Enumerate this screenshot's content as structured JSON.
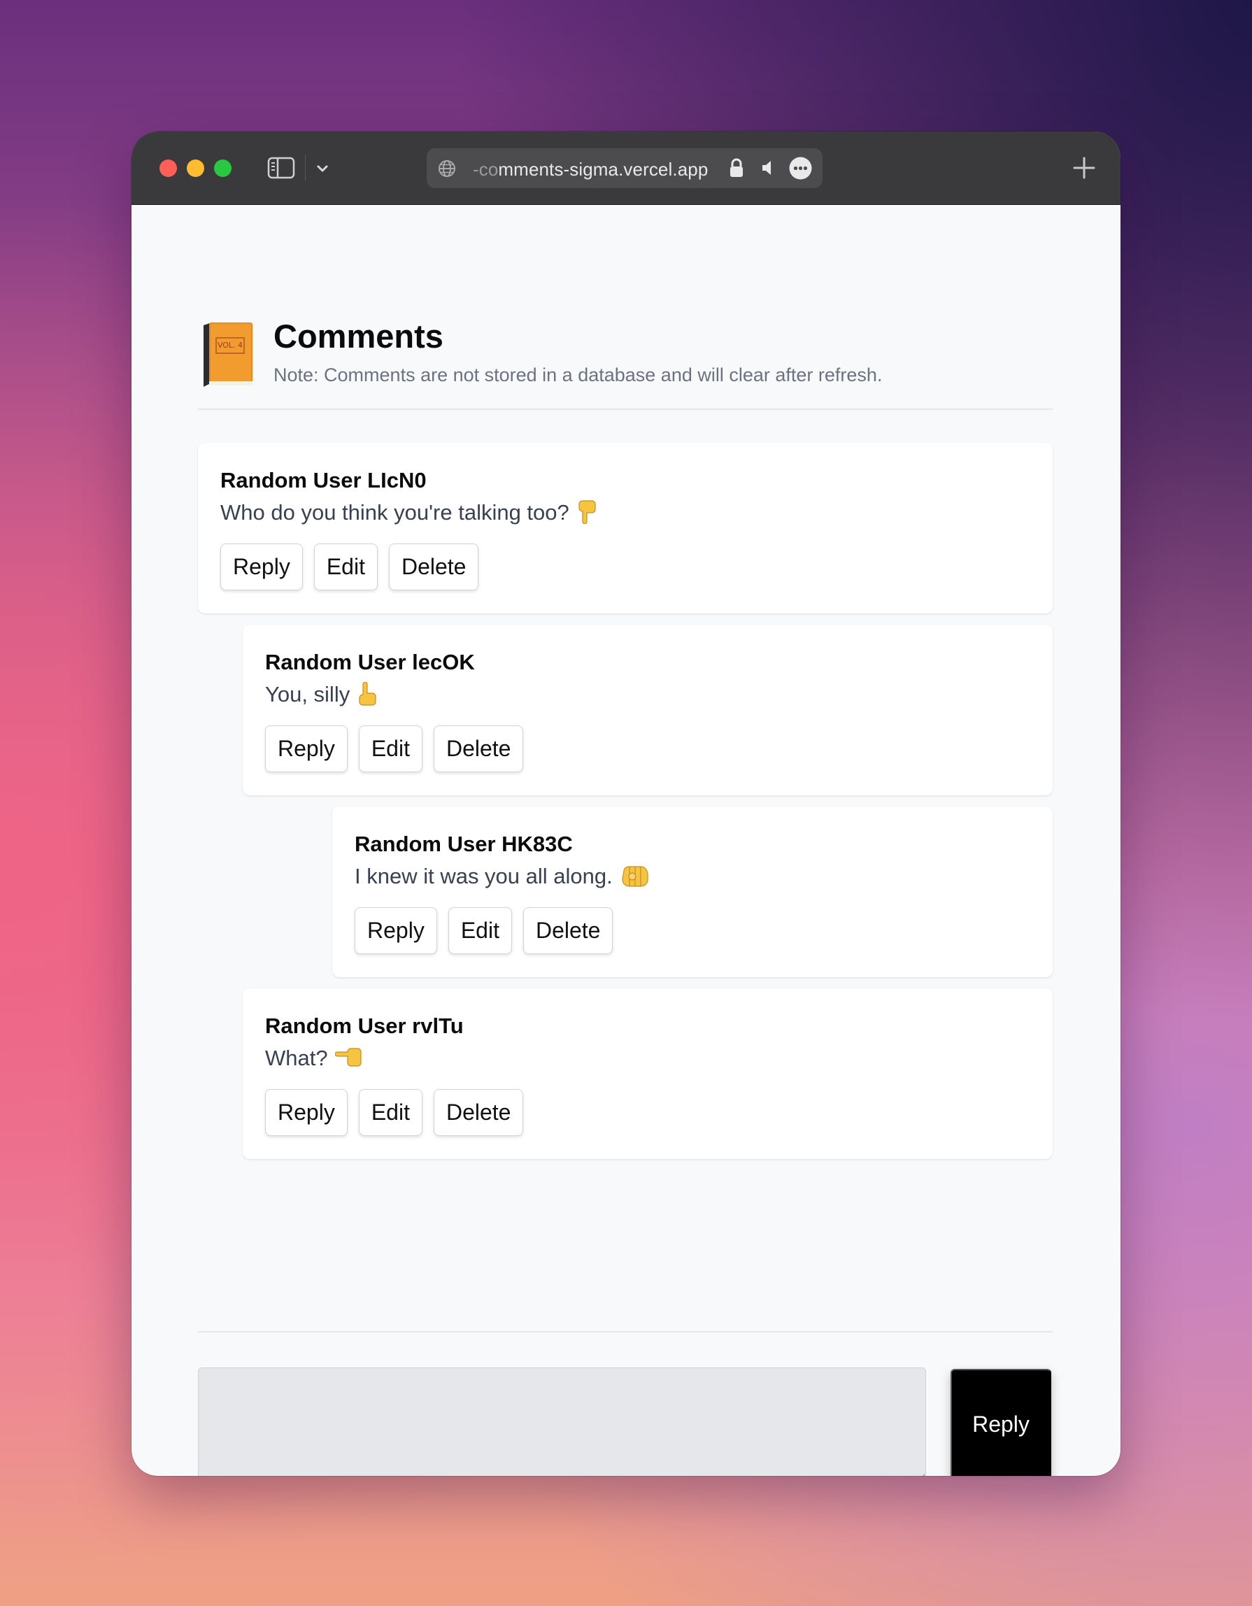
{
  "browser": {
    "url_prefix": "-co",
    "url_text": "mments-sigma.vercel.app",
    "icons": [
      "sidebar-icon",
      "chevron-down-icon",
      "globe-icon",
      "lock-icon",
      "speaker-icon",
      "more-icon",
      "plus-icon"
    ]
  },
  "header": {
    "title": "Comments",
    "note": "Note: Comments are not stored in a database and will clear after refresh.",
    "icon": "book-icon"
  },
  "comments": [
    {
      "author": "Random User LIcN0",
      "body": "Who do you think you're talking too?",
      "emoji": "point-down-icon",
      "reply": "Reply",
      "edit": "Edit",
      "delete": "Delete"
    },
    {
      "author": "Random User lecOK",
      "body": "You, silly",
      "emoji": "point-up-icon",
      "reply": "Reply",
      "edit": "Edit",
      "delete": "Delete"
    },
    {
      "author": "Random User HK83C",
      "body": "I knew it was you all along.",
      "emoji": "point-at-viewer-icon",
      "reply": "Reply",
      "edit": "Edit",
      "delete": "Delete"
    },
    {
      "author": "Random User rvlTu",
      "body": "What?",
      "emoji": "point-left-icon",
      "reply": "Reply",
      "edit": "Edit",
      "delete": "Delete"
    }
  ],
  "composer": {
    "value": "",
    "submit_label": "Reply"
  }
}
